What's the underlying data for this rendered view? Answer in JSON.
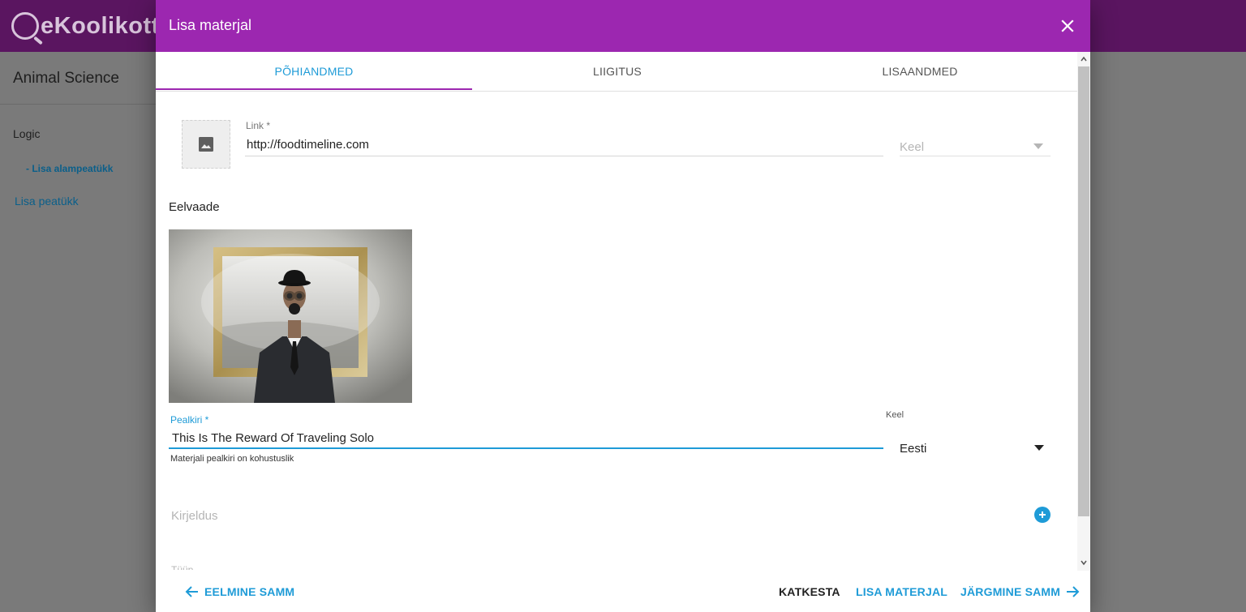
{
  "app": {
    "logo_text": "eKoolikott",
    "course_title": "Animal Science",
    "chapter": "Logic",
    "add_subchapter": "- Lisa alampeatükk",
    "add_chapter": "Lisa peatükk"
  },
  "modal": {
    "title": "Lisa materjal",
    "tabs": [
      {
        "label": "PÕHIANDMED",
        "active": true
      },
      {
        "label": "LIIGITUS",
        "active": false
      },
      {
        "label": "LISAANDMED",
        "active": false
      }
    ],
    "link": {
      "label": "Link *",
      "value": "http://foodtimeline.com"
    },
    "language_top": {
      "placeholder": "Keel"
    },
    "preview": {
      "label": "Eelvaade"
    },
    "title_field": {
      "label": "Pealkiri *",
      "value": "This Is The Reward Of Traveling Solo",
      "hint": "Materjali pealkiri on kohustuslik"
    },
    "language_title": {
      "label": "Keel",
      "value": "Eesti"
    },
    "description": {
      "placeholder": "Kirjeldus"
    },
    "next_field_cut": "Tüüp",
    "footer": {
      "prev": "EELMINE SAMM",
      "cancel": "KATKESTA",
      "add": "LISA MATERJAL",
      "next": "JÄRGMINE SAMM"
    }
  },
  "colors": {
    "header_purple": "#9c27b0",
    "accent_blue": "#1e9bd7"
  }
}
